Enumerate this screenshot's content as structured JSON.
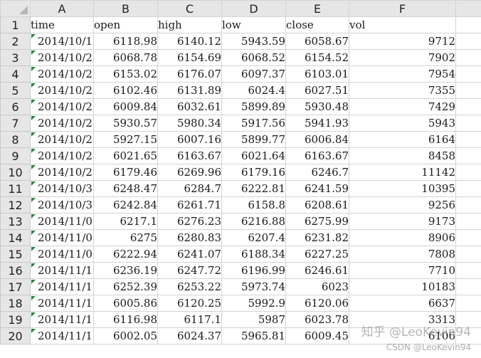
{
  "columns": [
    "A",
    "B",
    "C",
    "D",
    "E",
    "F"
  ],
  "row_numbers": [
    "1",
    "2",
    "3",
    "4",
    "5",
    "6",
    "7",
    "8",
    "9",
    "10",
    "11",
    "12",
    "13",
    "14",
    "15",
    "16",
    "17",
    "18",
    "19",
    "20"
  ],
  "header_row": [
    "time",
    "open",
    "high",
    "low",
    "close",
    "vol"
  ],
  "rows": [
    [
      "2014/10/1",
      "6118.98",
      "6140.12",
      "5943.59",
      "6058.67",
      "9712"
    ],
    [
      "2014/10/2",
      "6068.78",
      "6154.69",
      "6068.52",
      "6154.52",
      "7902"
    ],
    [
      "2014/10/2",
      "6153.02",
      "6176.07",
      "6097.37",
      "6103.01",
      "7954"
    ],
    [
      "2014/10/2",
      "6102.46",
      "6131.89",
      "6024.4",
      "6027.51",
      "7355"
    ],
    [
      "2014/10/2",
      "6009.84",
      "6032.61",
      "5899.89",
      "5930.48",
      "7429"
    ],
    [
      "2014/10/2",
      "5930.57",
      "5980.34",
      "5917.56",
      "5941.93",
      "5943"
    ],
    [
      "2014/10/2",
      "5927.15",
      "6007.16",
      "5899.77",
      "6006.84",
      "6164"
    ],
    [
      "2014/10/2",
      "6021.65",
      "6163.67",
      "6021.64",
      "6163.67",
      "8458"
    ],
    [
      "2014/10/2",
      "6179.46",
      "6269.96",
      "6179.16",
      "6246.7",
      "11142"
    ],
    [
      "2014/10/3",
      "6248.47",
      "6284.7",
      "6222.81",
      "6241.59",
      "10395"
    ],
    [
      "2014/10/3",
      "6242.84",
      "6261.71",
      "6158.8",
      "6208.61",
      "9256"
    ],
    [
      "2014/11/0",
      "6217.1",
      "6276.23",
      "6216.88",
      "6275.99",
      "9173"
    ],
    [
      "2014/11/0",
      "6275",
      "6280.83",
      "6207.4",
      "6231.82",
      "8906"
    ],
    [
      "2014/11/0",
      "6222.94",
      "6241.07",
      "6188.34",
      "6227.25",
      "7808"
    ],
    [
      "2014/11/1",
      "6236.19",
      "6247.72",
      "6196.99",
      "6246.61",
      "7710"
    ],
    [
      "2014/11/1",
      "6252.39",
      "6253.22",
      "5973.74",
      "6023",
      "10183"
    ],
    [
      "2014/11/1",
      "6005.86",
      "6120.25",
      "5992.9",
      "6120.06",
      "6637"
    ],
    [
      "2014/11/1",
      "6116.98",
      "6117.1",
      "5987",
      "6023.78",
      "3313"
    ],
    [
      "2014/11/1",
      "6002.05",
      "6024.37",
      "5965.81",
      "6009.45",
      "6106"
    ]
  ],
  "watermark": {
    "line1": "知乎 @LeoKevin94",
    "line2": "CSDN @LeoKevin94"
  }
}
